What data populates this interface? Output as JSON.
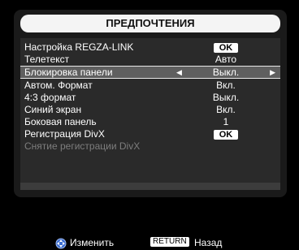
{
  "title": "ПРЕДПОЧТЕНИЯ",
  "menu": {
    "items": [
      {
        "label": "Настройка REGZA-LINK",
        "value": "OK",
        "kind": "button"
      },
      {
        "label": "Телетекст",
        "value": "Авто",
        "kind": "text"
      },
      {
        "label": "Блокировка панели",
        "value": "Выкл.",
        "kind": "selector",
        "selected": true
      },
      {
        "label": "Автом. Формат",
        "value": "Вкл.",
        "kind": "text"
      },
      {
        "label": "4:3 формат",
        "value": "Выкл.",
        "kind": "text"
      },
      {
        "label": "Синий экран",
        "value": "Вкл.",
        "kind": "text"
      },
      {
        "label": "Боковая панель",
        "value": "1",
        "kind": "text"
      },
      {
        "label": "Регистрация DivX",
        "value": "OK",
        "kind": "button"
      },
      {
        "label": "Снятие регистрации DivX",
        "value": "",
        "kind": "disabled"
      }
    ]
  },
  "footer": {
    "change_label": "Изменить",
    "return_key": "RETURN",
    "back_label": "Назад"
  },
  "colors": {
    "background": "#000000",
    "panel": "#1a1a1a",
    "menu": "#2a2a2a",
    "selected_row": "#5f5f5f",
    "disabled_text": "#7d7d7d"
  },
  "icons": {
    "left_arrow": "left-arrow-icon",
    "right_arrow": "right-arrow-icon",
    "navigation": "nav-pad-icon"
  }
}
